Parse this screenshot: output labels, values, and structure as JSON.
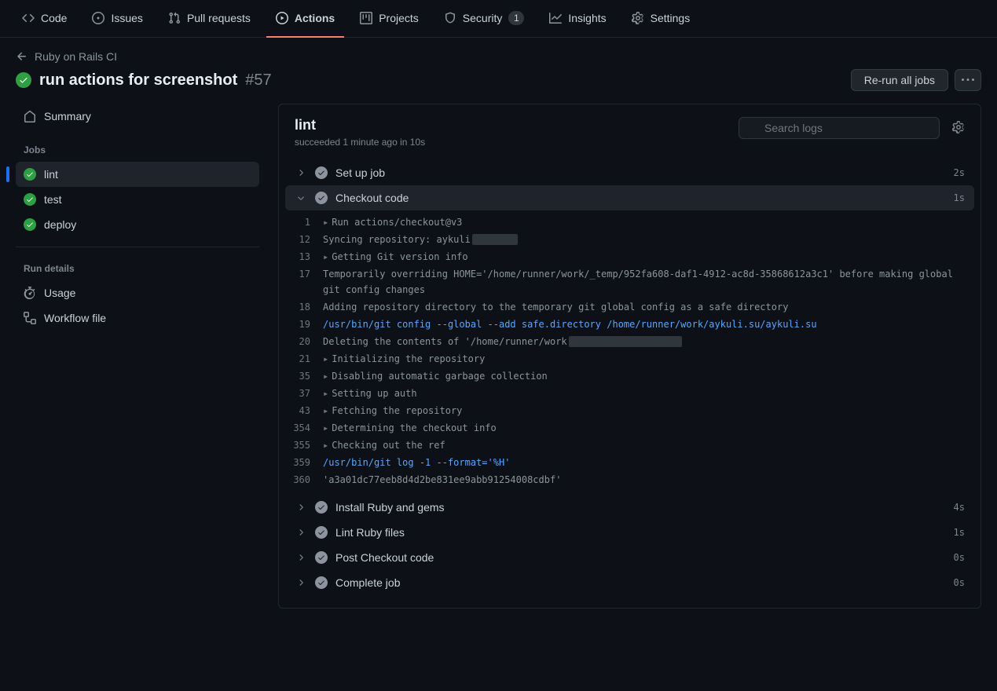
{
  "nav": {
    "code": "Code",
    "issues": "Issues",
    "pulls": "Pull requests",
    "actions": "Actions",
    "projects": "Projects",
    "security": "Security",
    "security_count": "1",
    "insights": "Insights",
    "settings": "Settings"
  },
  "header": {
    "back_label": "Ruby on Rails CI",
    "title": "run actions for screenshot",
    "run_number": "#57",
    "rerun_label": "Re-run all jobs"
  },
  "sidebar": {
    "summary": "Summary",
    "jobs_heading": "Jobs",
    "jobs": [
      {
        "name": "lint"
      },
      {
        "name": "test"
      },
      {
        "name": "deploy"
      }
    ],
    "run_details_heading": "Run details",
    "usage": "Usage",
    "workflow": "Workflow file"
  },
  "job": {
    "name": "lint",
    "status": "succeeded 1 minute ago in 10s",
    "search_placeholder": "Search logs"
  },
  "steps": [
    {
      "name": "Set up job",
      "time": "2s",
      "expanded": false
    },
    {
      "name": "Checkout code",
      "time": "1s",
      "expanded": true
    },
    {
      "name": "Install Ruby and gems",
      "time": "4s",
      "expanded": false
    },
    {
      "name": "Lint Ruby files",
      "time": "1s",
      "expanded": false
    },
    {
      "name": "Post Checkout code",
      "time": "0s",
      "expanded": false
    },
    {
      "name": "Complete job",
      "time": "0s",
      "expanded": false
    }
  ],
  "logs": [
    {
      "num": "1",
      "expand": true,
      "text": "Run actions/checkout@v3"
    },
    {
      "num": "12",
      "text": "Syncing repository: aykuli",
      "redact": "xxxxxxxx"
    },
    {
      "num": "13",
      "expand": true,
      "text": "Getting Git version info"
    },
    {
      "num": "17",
      "text": "Temporarily overriding HOME='/home/runner/work/_temp/952fa608-daf1-4912-ac8d-35868612a3c1' before making global git config changes"
    },
    {
      "num": "18",
      "text": "Adding repository directory to the temporary git global config as a safe directory"
    },
    {
      "num": "19",
      "blue": true,
      "text": "/usr/bin/git config --global --add safe.directory /home/runner/work/aykuli.su/aykuli.su"
    },
    {
      "num": "20",
      "text": "Deleting the contents of '/home/runner/work",
      "redact": "xxxxxxxxxxxxxxxxxxxx"
    },
    {
      "num": "21",
      "expand": true,
      "text": "Initializing the repository"
    },
    {
      "num": "35",
      "expand": true,
      "text": "Disabling automatic garbage collection"
    },
    {
      "num": "37",
      "expand": true,
      "text": "Setting up auth"
    },
    {
      "num": "43",
      "expand": true,
      "text": "Fetching the repository"
    },
    {
      "num": "354",
      "expand": true,
      "text": "Determining the checkout info"
    },
    {
      "num": "355",
      "expand": true,
      "text": "Checking out the ref"
    },
    {
      "num": "359",
      "blue": true,
      "text": "/usr/bin/git log -1 --format='%H'"
    },
    {
      "num": "360",
      "text": "'a3a01dc77eeb8d4d2be831ee9abb91254008cdbf'"
    }
  ]
}
